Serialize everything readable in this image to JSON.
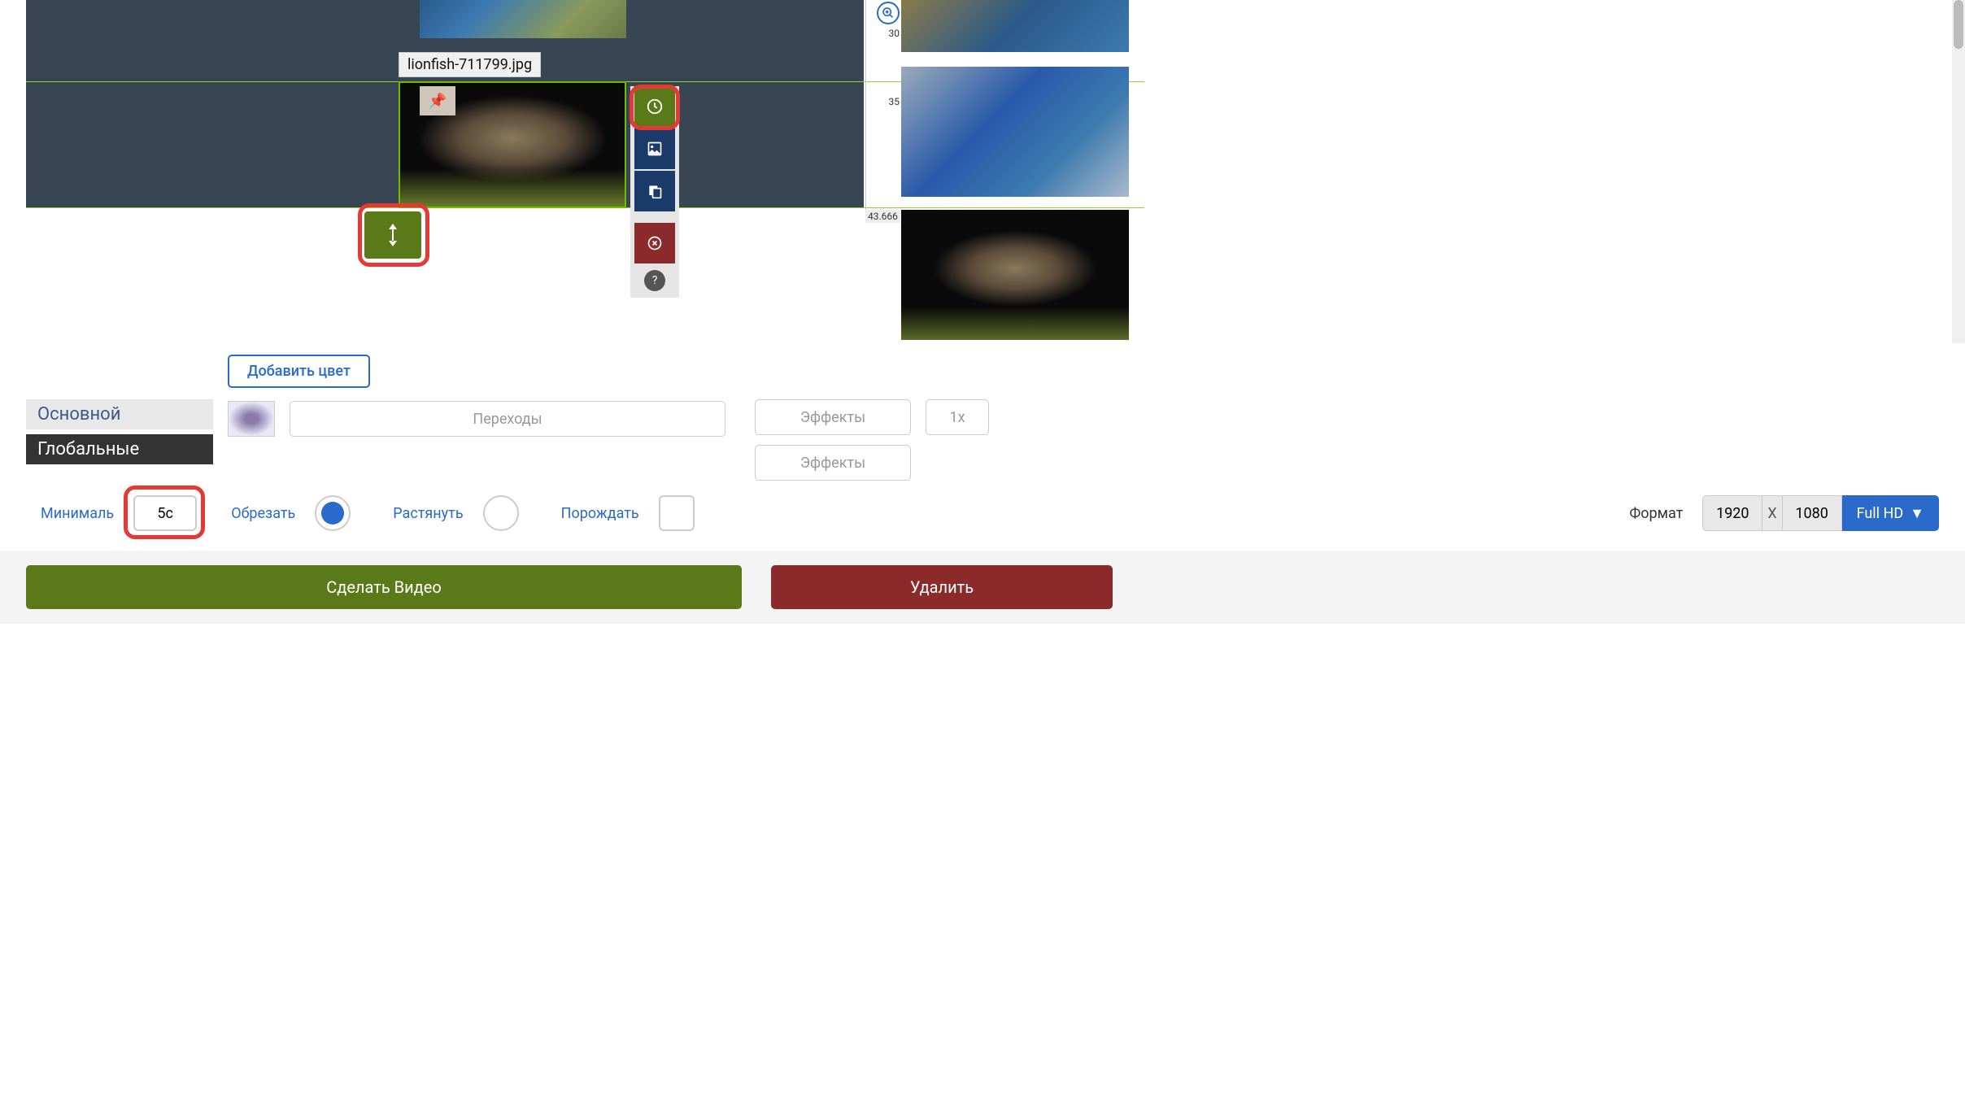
{
  "clip": {
    "filename": "lionfish-711799.jpg"
  },
  "ruler": {
    "t1": "30",
    "t2": "35",
    "ts": "43.666"
  },
  "controls": {
    "add_color": "Добавить цвет",
    "main_label": "Основной",
    "global_label": "Глобальные",
    "transitions": "Переходы",
    "effects": "Эффекты",
    "speed": "1x",
    "min_label": "Минималь",
    "min_value": "5с",
    "crop": "Обрезать",
    "stretch": "Растянуть",
    "spawn": "Порождать",
    "format": "Формат",
    "width": "1920",
    "height": "1080",
    "x": "X",
    "preset": "Full HD"
  },
  "footer": {
    "make": "Сделать Видео",
    "delete": "Удалить"
  }
}
